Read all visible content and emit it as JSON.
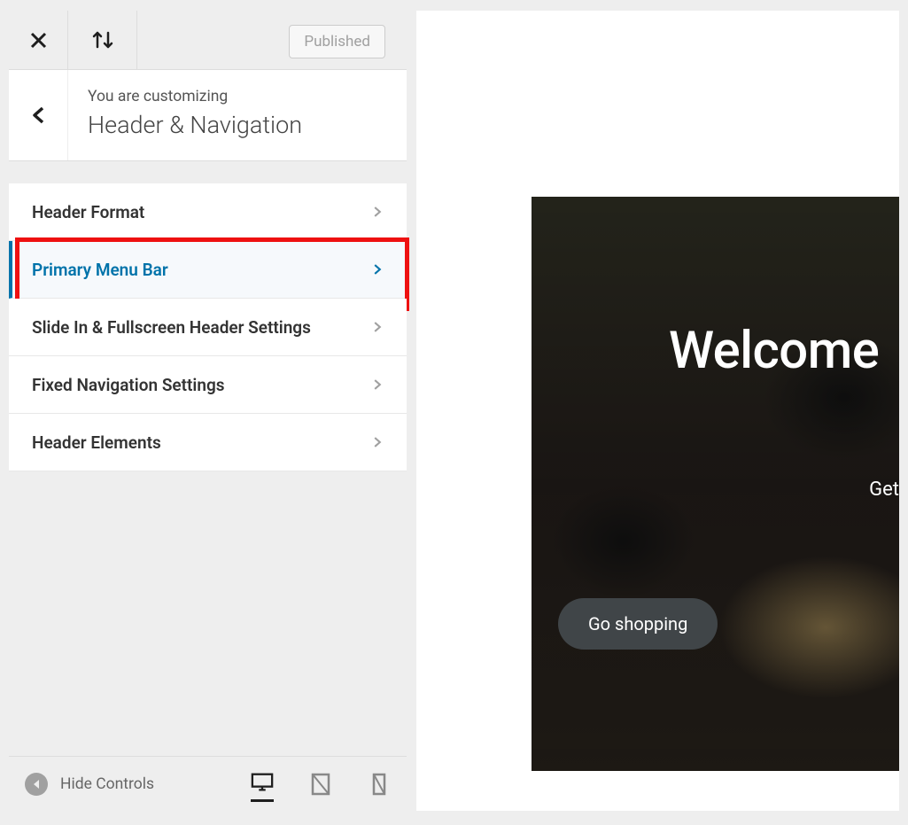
{
  "toolbar": {
    "published_label": "Published"
  },
  "header": {
    "customizing_label": "You are customizing",
    "section_title": "Header & Navigation"
  },
  "menu": {
    "items": [
      {
        "label": "Header Format",
        "highlighted": false
      },
      {
        "label": "Primary Menu Bar",
        "highlighted": true
      },
      {
        "label": "Slide In & Fullscreen Header Settings",
        "highlighted": false
      },
      {
        "label": "Fixed Navigation Settings",
        "highlighted": false
      },
      {
        "label": "Header Elements",
        "highlighted": false
      }
    ]
  },
  "bottom": {
    "hide_controls_label": "Hide Controls"
  },
  "preview": {
    "welcome_text": "Welcome",
    "subtitle_text": "Get",
    "button_label": "Go shopping"
  }
}
